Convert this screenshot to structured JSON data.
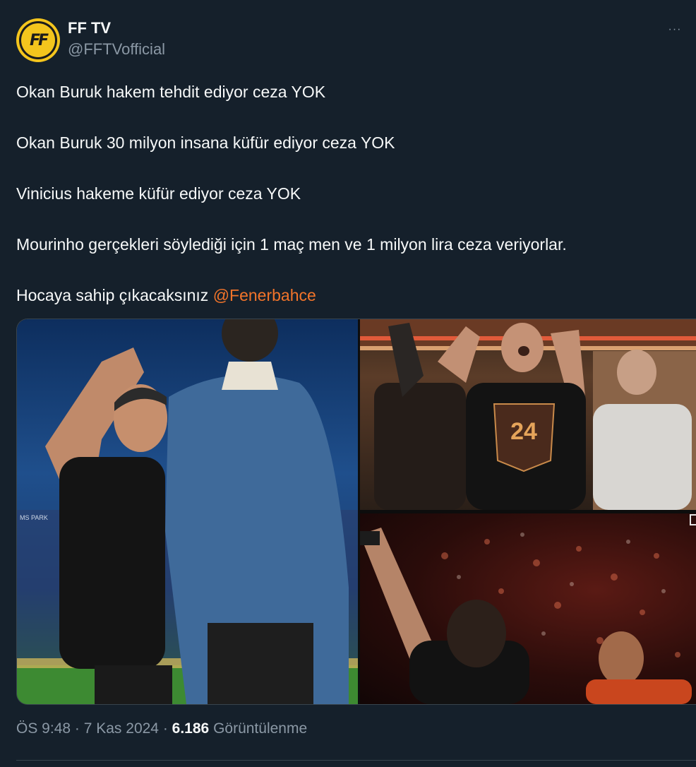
{
  "author": {
    "display_name": "FF TV",
    "handle": "@FFTVofficial",
    "avatar_text": "FF"
  },
  "more_label": "···",
  "tweet": {
    "lines": [
      "Okan Buruk hakem tehdit ediyor ceza YOK",
      "Okan Buruk 30 milyon insana küfür ediyor ceza YOK",
      "Vinicius hakeme küfür ediyor ceza YOK",
      "Mourinho gerçekleri söylediği için 1 maç men ve 1 milyon lira ceza veriyorlar."
    ],
    "last_line_prefix": "Hocaya sahip çıkacaksınız ",
    "mention": "@Fenerbahce"
  },
  "media": [
    {
      "alt": "Stadium photo: coach in black shirt next to man in blue suit"
    },
    {
      "alt": "Fans cheering in a stadium box, shirt number 24"
    },
    {
      "alt": "Referee raising arm, crowd in red stands behind"
    }
  ],
  "media_overlay_text": {
    "park": "MS PARK",
    "shirt_number": "24"
  },
  "meta": {
    "time": "ÖS 9:48",
    "sep1": " · ",
    "date": "7 Kas 2024",
    "sep2": " · ",
    "views_count": "6.186",
    "views_label": " Görüntülenme"
  },
  "colors": {
    "background": "#15202b",
    "text": "#f7f9f9",
    "secondary": "#8b98a5",
    "mention": "#f2742a",
    "brand_yellow": "#f4c51d"
  }
}
